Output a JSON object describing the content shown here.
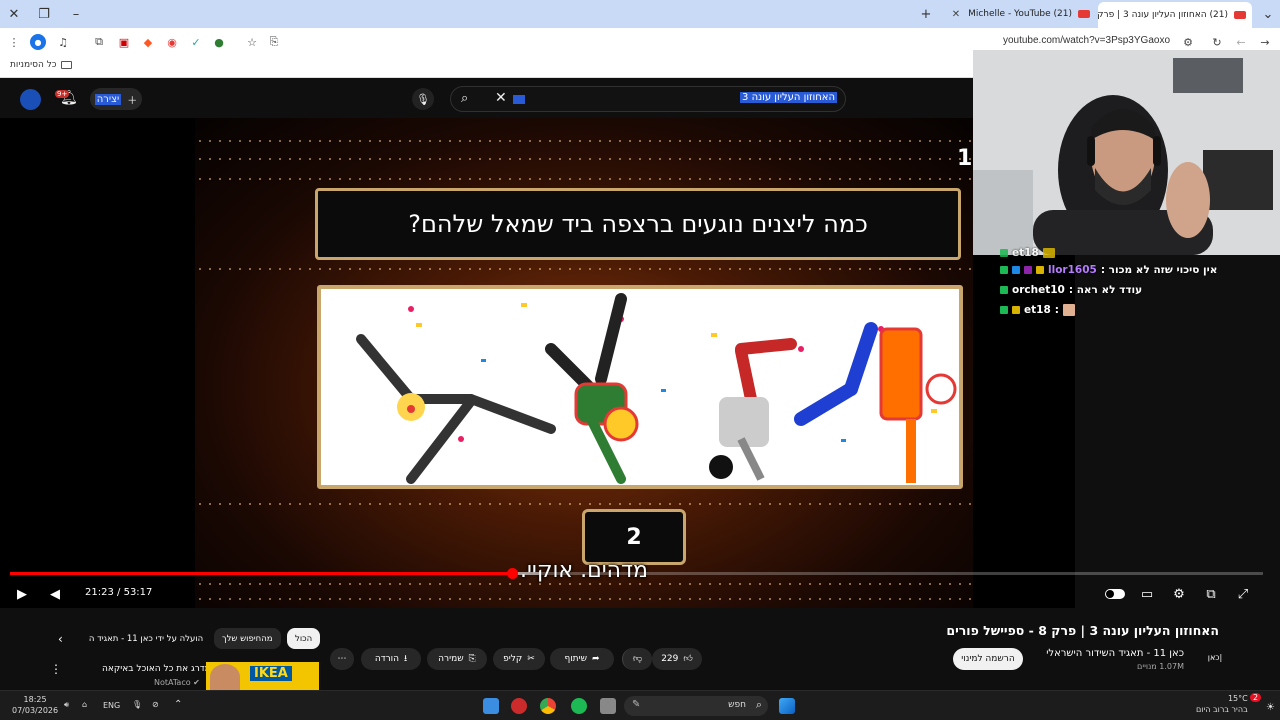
{
  "browser": {
    "tabs": [
      {
        "label": "(21) האחוזון העליון עונה 3 | פרק",
        "active": true
      },
      {
        "label": "(21) Michelle - YouTube",
        "active": false
      }
    ],
    "url": "youtube.com/watch?v=3Psp3YGaoxo",
    "bookmarks_label": "כל הסימניות"
  },
  "header": {
    "create_label": "יצירה",
    "notification_badge": "9+",
    "search_query": "האחוזון העליון עונה 3"
  },
  "video": {
    "question": "כמה ליצנים נוגעים ברצפה ביד שמאל שלהם?",
    "answer": "2",
    "subtitle": "מדהים. אוקיי.",
    "logo_number": "11",
    "time_current": "21:23",
    "time_separator": "/",
    "time_total": "53:17",
    "progress_fraction": 0.401,
    "loaded_fraction": 0.422
  },
  "chat": [
    {
      "user": "et18",
      "text": "",
      "colors": [
        "#1db954",
        "#d8b400"
      ],
      "emote": true,
      "partial": true
    },
    {
      "user": "llor1605",
      "text": "אין סיכוי שזה לא מכור :",
      "colors": [
        "#1db954",
        "#1e88e5",
        "#8e24aa",
        "#d8b400"
      ],
      "user_color": "#b57cff"
    },
    {
      "user": "orchet10",
      "text": "עודד לא ראה :",
      "colors": [
        "#1db954"
      ],
      "user_color": "#ffffff"
    },
    {
      "user": "et18",
      "text": ":",
      "colors": [
        "#1db954",
        "#d8b400"
      ],
      "emote": true,
      "user_color": "#ffffff"
    }
  ],
  "below": {
    "title": "האחוזון העליון עונה 3 | פרק 8 - ספיישל פורים",
    "channel_logo": "כאן|",
    "channel_name": "כאן 11 - תאגיד השידור הישראלי",
    "subscribers": "1.07M מנויים",
    "subscribe_label": "הרשמה למינוי",
    "like_count": "229",
    "share_label": "שיתוף",
    "clip_label": "קליפ",
    "save_label": "שמירה",
    "download_label": "הורדה",
    "chips": [
      "הכול",
      "מהחיפוש שלך",
      "הועלה על ידי כאן 11 - תאגיד ה"
    ],
    "rec_title": "מדרג את כל האוכל באיקאה",
    "rec_channel": "NotATaco",
    "rec_thumb_text": "IKEA"
  },
  "taskbar": {
    "time": "18:25",
    "date": "07/03/2026",
    "lang": "ENG",
    "search_placeholder": "חפש",
    "weather_temp": "15°C",
    "weather_desc": "בהיר ברוב היום",
    "notif_count": "2"
  }
}
